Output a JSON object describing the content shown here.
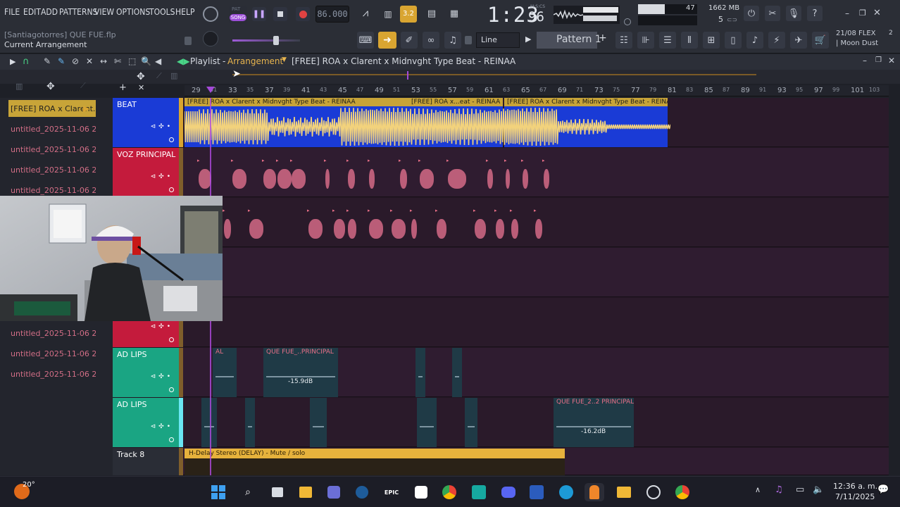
{
  "project": {
    "user_file": "[Santiagotorres] QUE FUE.flp",
    "hint": "Current Arrangement"
  },
  "menu": [
    "FILE",
    "EDIT",
    "ADD",
    "PATTERNS",
    "VIEW",
    "OPTIONS",
    "TOOLS",
    "HELP"
  ],
  "transport": {
    "pat_label": "PAT",
    "song_label": "SONG",
    "tempo": "86.000",
    "time": "1:23",
    "time_small": "96",
    "time_unit": "M:S:CS",
    "step": "3.2"
  },
  "meters": {
    "cpu": "47",
    "memory": "1662 MB",
    "polyphony": "5"
  },
  "toolbar2": {
    "snap_mode": "Line",
    "pattern": "Pattern 1"
  },
  "news": {
    "line1": "21/08  FLEX",
    "line2": "| Moon Dust",
    "counter": "2"
  },
  "playlist": {
    "title": "Playlist",
    "separator": "-",
    "view": "Arrangement",
    "arrangement_name": "[FREE] ROA x Clarent x Midnvght Type Beat - REINAA"
  },
  "ruler": [
    "29",
    "31",
    "33",
    "35",
    "37",
    "39",
    "41",
    "43",
    "45",
    "47",
    "49",
    "51",
    "53",
    "55",
    "57",
    "59",
    "61",
    "63",
    "65",
    "67",
    "69",
    "71",
    "73",
    "75",
    "77",
    "79",
    "81",
    "83",
    "85",
    "87",
    "89",
    "91",
    "93",
    "95",
    "97",
    "99",
    "101",
    "103"
  ],
  "picker": [
    "[FREE] ROA x Clarent...",
    "untitled_2025-11-06 20-...",
    "untitled_2025-11-06 20-...",
    "untitled_2025-11-06 20-...",
    "untitled_2025-11-06 20-...",
    "untitled_2025-11-06 20-...",
    "untitled_2025-11-06 20-...",
    "untitled_2025-11-06 20-...",
    "untitled_2025-11-06 20-...",
    "untitled_2025-11-06 20-...",
    "untitled_2025-11-06 20-...",
    "untitled_2025-11-06 20-...",
    "untitled_2025-11-06 20-...",
    "untitled_2025-11-06 20-..."
  ],
  "tracks": [
    {
      "name": "BEAT",
      "color": "#1a3bd6"
    },
    {
      "name": "VOZ PRINCIPAL",
      "color": "#c41b3c"
    },
    {
      "name": "",
      "color": "#c41b3c"
    },
    {
      "name": "",
      "color": "#c41b3c"
    },
    {
      "name": "",
      "color": "#c41b3c"
    },
    {
      "name": "AD LIPS",
      "color": "#1aa583"
    },
    {
      "name": "AD LIPS",
      "color": "#1aa583"
    },
    {
      "name": "Track 8",
      "color": "#2a2d36"
    }
  ],
  "clips": {
    "beat1": "[FREE] ROA x Clarent x Midnvght Type Beat - REINAA",
    "beat2": "[FREE] ROA x...eat - REINAA",
    "beat3": "[FREE] ROA x Clarent x Midnvght Type Beat - REINAA",
    "adlips1a": "AL",
    "adlips1b": "QUE FUE_..PRINCIPAL",
    "adlips1_db": "-15.9dB",
    "adlips2": "QUE FUE_2..2 PRINCIPAL",
    "adlips2_db": "-16.2dB",
    "automation": "H-Delay Stereo (DELAY) - Mute / solo"
  },
  "taskbar": {
    "weather": "20°",
    "time": "12:36 a. m.",
    "date": "7/11/2025",
    "epic": "EPIC"
  },
  "colors": {
    "beat_clip": "#1a3bd6",
    "waveform": "#f2d27c",
    "vocal": "#d46a86",
    "adlips": "#1aa583",
    "clip_header": "#c8a438"
  }
}
